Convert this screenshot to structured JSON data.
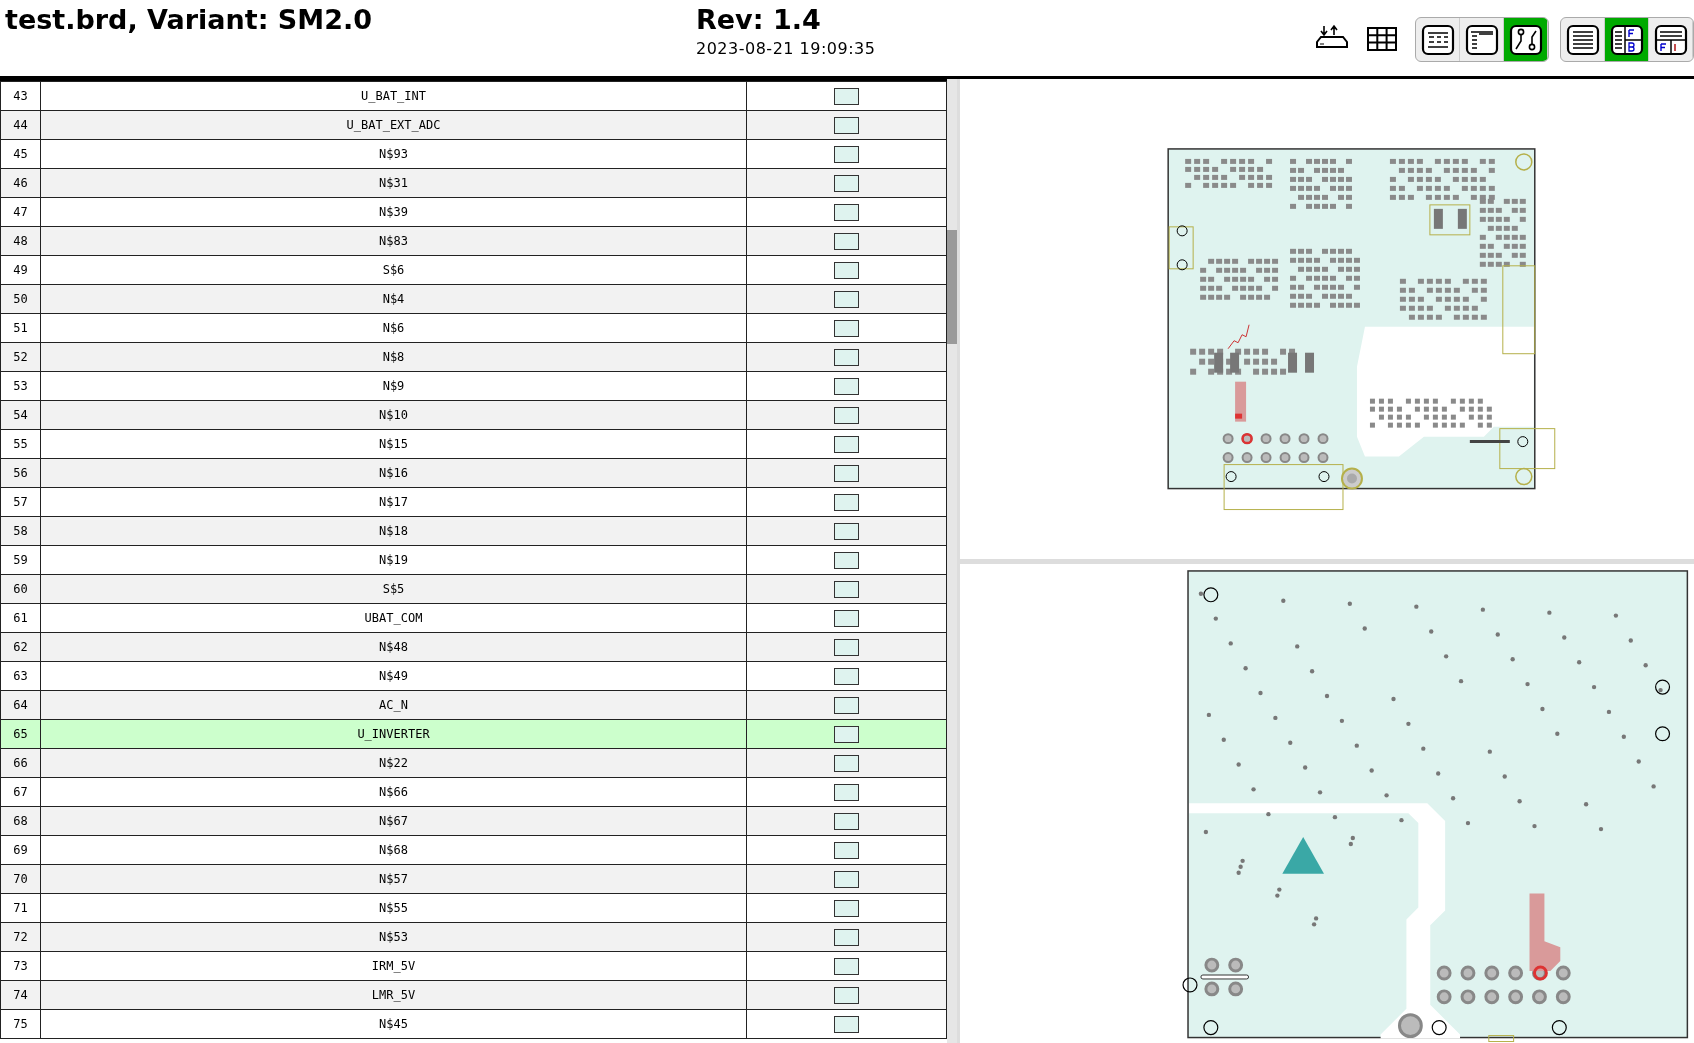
{
  "header": {
    "title": "test.brd, Variant: SM2.0",
    "revision": "Rev: 1.4",
    "date": "2023-08-21 19:09:35"
  },
  "toolbar": [
    {
      "kind": "plain",
      "buttons": [
        {
          "kind": "settings",
          "selected": false
        },
        {
          "kind": "grid",
          "selected": false
        }
      ]
    },
    {
      "kind": "framed",
      "buttons": [
        {
          "kind": "bom-only",
          "selected": false
        },
        {
          "kind": "bom-left-right",
          "selected": false
        },
        {
          "kind": "netlist",
          "selected": true
        }
      ]
    },
    {
      "kind": "framed",
      "buttons": [
        {
          "kind": "layer-single",
          "selected": false
        },
        {
          "kind": "layer-front-back",
          "selected": true
        },
        {
          "kind": "layer-top-bottom",
          "selected": false
        }
      ]
    }
  ],
  "table": {
    "rows": [
      {
        "number": "43",
        "net": "U_BAT_INT",
        "selected": false
      },
      {
        "number": "44",
        "net": "U_BAT_EXT_ADC",
        "selected": false
      },
      {
        "number": "45",
        "net": "N$93",
        "selected": false
      },
      {
        "number": "46",
        "net": "N$31",
        "selected": false
      },
      {
        "number": "47",
        "net": "N$39",
        "selected": false
      },
      {
        "number": "48",
        "net": "N$83",
        "selected": false
      },
      {
        "number": "49",
        "net": "S$6",
        "selected": false
      },
      {
        "number": "50",
        "net": "N$4",
        "selected": false
      },
      {
        "number": "51",
        "net": "N$6",
        "selected": false
      },
      {
        "number": "52",
        "net": "N$8",
        "selected": false
      },
      {
        "number": "53",
        "net": "N$9",
        "selected": false
      },
      {
        "number": "54",
        "net": "N$10",
        "selected": false
      },
      {
        "number": "55",
        "net": "N$15",
        "selected": false
      },
      {
        "number": "56",
        "net": "N$16",
        "selected": false
      },
      {
        "number": "57",
        "net": "N$17",
        "selected": false
      },
      {
        "number": "58",
        "net": "N$18",
        "selected": false
      },
      {
        "number": "59",
        "net": "N$19",
        "selected": false
      },
      {
        "number": "60",
        "net": "S$5",
        "selected": false
      },
      {
        "number": "61",
        "net": "UBAT_COM",
        "selected": false
      },
      {
        "number": "62",
        "net": "N$48",
        "selected": false
      },
      {
        "number": "63",
        "net": "N$49",
        "selected": false
      },
      {
        "number": "64",
        "net": "AC_N",
        "selected": false
      },
      {
        "number": "65",
        "net": "U_INVERTER",
        "selected": true
      },
      {
        "number": "66",
        "net": "N$22",
        "selected": false
      },
      {
        "number": "67",
        "net": "N$66",
        "selected": false
      },
      {
        "number": "68",
        "net": "N$67",
        "selected": false
      },
      {
        "number": "69",
        "net": "N$68",
        "selected": false
      },
      {
        "number": "70",
        "net": "N$57",
        "selected": false
      },
      {
        "number": "71",
        "net": "N$55",
        "selected": false
      },
      {
        "number": "72",
        "net": "N$53",
        "selected": false
      },
      {
        "number": "73",
        "net": "IRM_5V",
        "selected": false
      },
      {
        "number": "74",
        "net": "LMR_5V",
        "selected": false
      },
      {
        "number": "75",
        "net": "N$45",
        "selected": false
      }
    ]
  }
}
